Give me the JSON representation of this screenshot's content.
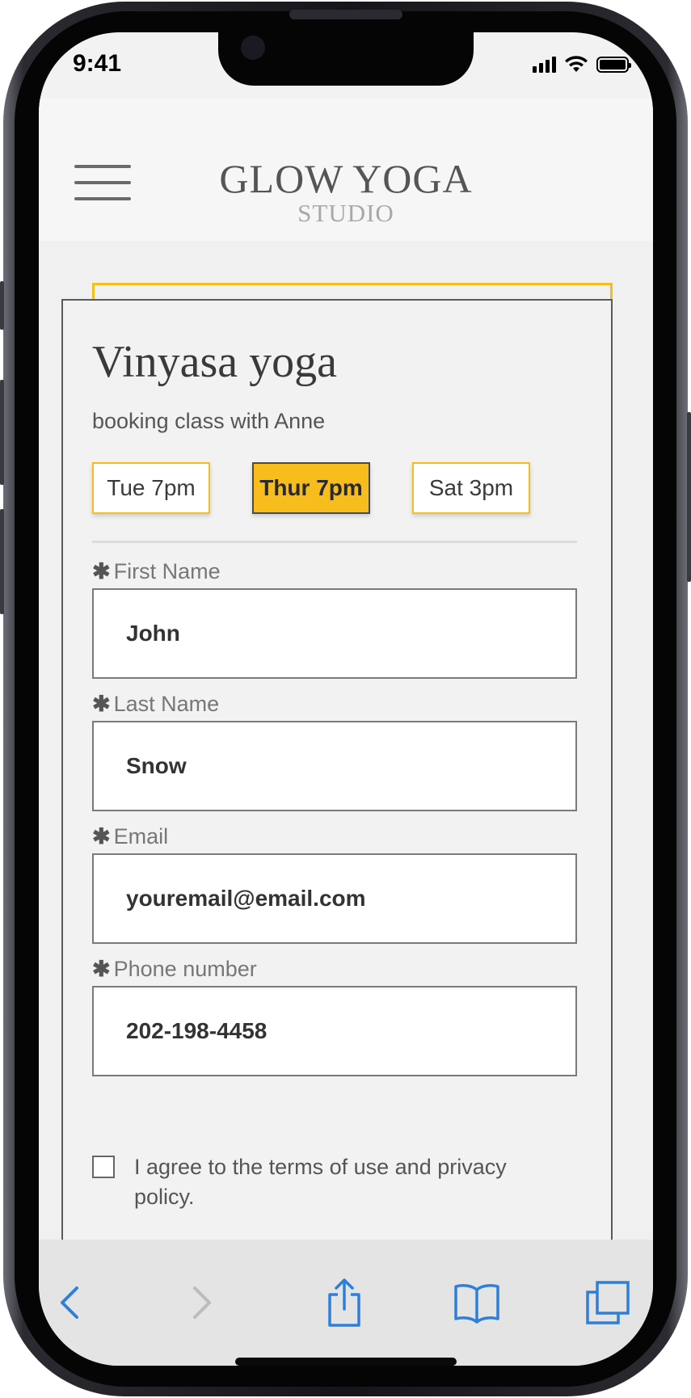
{
  "status_bar": {
    "time": "9:41"
  },
  "header": {
    "logo_title": "GLOW YOGA",
    "logo_subtitle": "STUDIO"
  },
  "booking": {
    "class_title": "Vinyasa yoga",
    "subtitle": "booking class with Anne",
    "time_slots": [
      {
        "label": "Tue 7pm",
        "selected": false
      },
      {
        "label": "Thur 7pm",
        "selected": true
      },
      {
        "label": "Sat 3pm",
        "selected": false
      }
    ],
    "required_mark": "✱",
    "fields": [
      {
        "label": "First Name",
        "value": "John"
      },
      {
        "label": "Last Name",
        "value": "Snow"
      },
      {
        "label": "Email",
        "value": "youremail@email.com"
      },
      {
        "label": "Phone number",
        "value": "202-198-4458"
      }
    ],
    "terms_checked": false,
    "terms_text": "I agree to the terms of use and privacy policy."
  },
  "toolbar": {
    "icons": [
      "back-icon",
      "forward-icon",
      "share-icon",
      "bookmarks-icon",
      "tabs-icon"
    ]
  },
  "colors": {
    "accent": "#f7bd1c",
    "ios_blue": "#2f7fd8",
    "frame_dark": "#5a5a5a"
  }
}
